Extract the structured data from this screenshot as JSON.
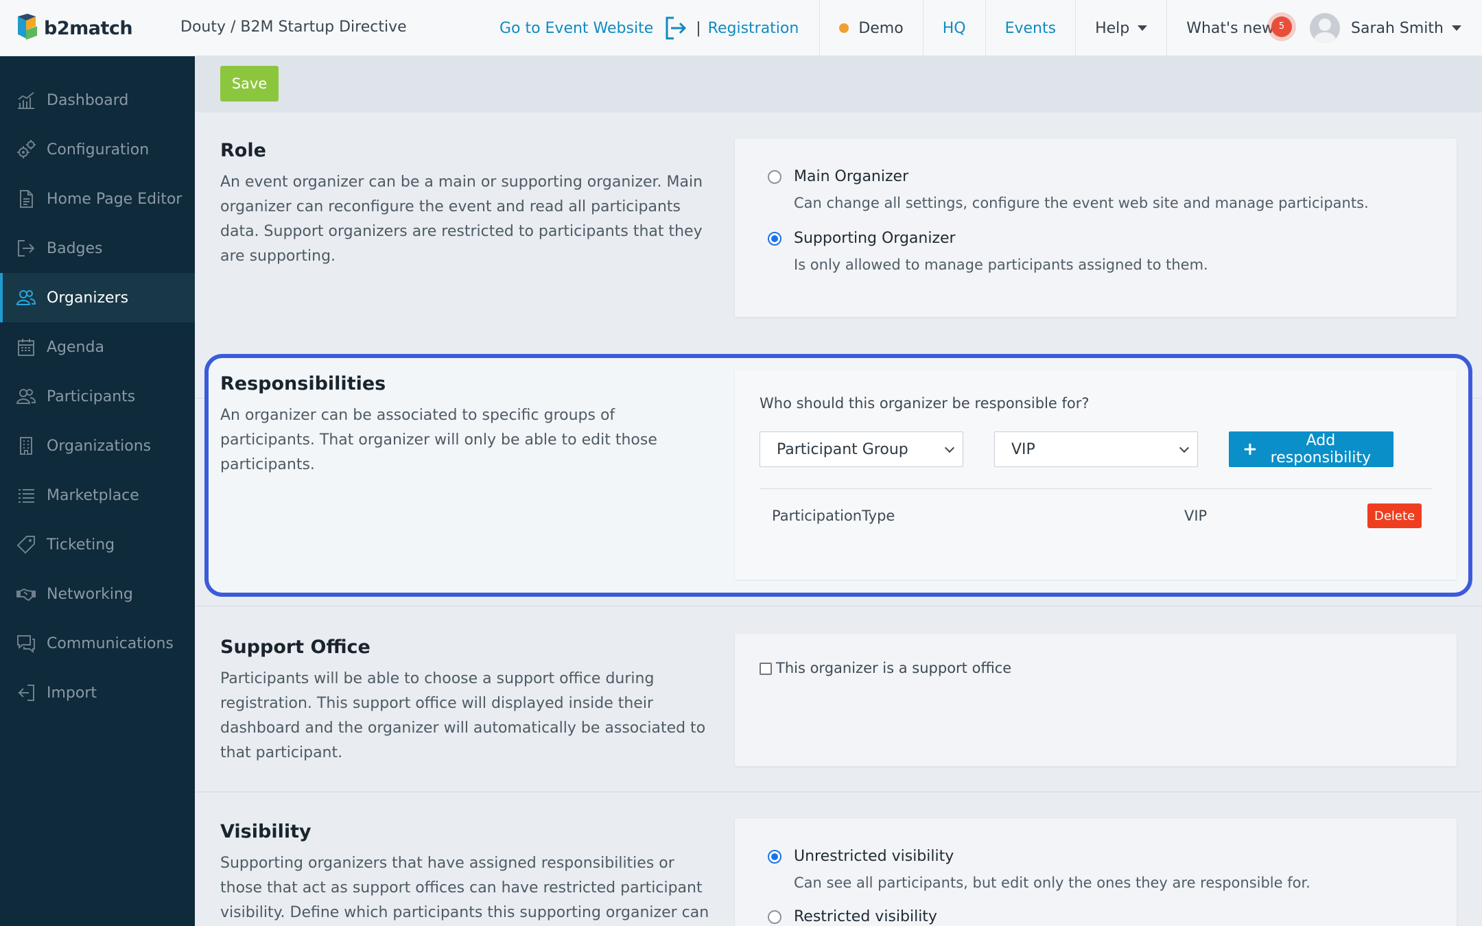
{
  "header": {
    "brand": "b2match",
    "event_path": "Douty / B2M Startup Directive",
    "go_to_site": "Go to Event Website",
    "separator": "|",
    "registration": "Registration",
    "demo": "Demo",
    "hq": "HQ",
    "events": "Events",
    "help": "Help",
    "whats_new": "What's new",
    "whats_new_count": "5",
    "user_name": "Sarah Smith"
  },
  "sidebar": {
    "items": [
      {
        "label": "Dashboard",
        "icon": "dashboard-icon"
      },
      {
        "label": "Configuration",
        "icon": "gears-icon"
      },
      {
        "label": "Home Page Editor",
        "icon": "document-icon"
      },
      {
        "label": "Badges",
        "icon": "sign-in-icon"
      },
      {
        "label": "Organizers",
        "icon": "users-icon",
        "active": true
      },
      {
        "label": "Agenda",
        "icon": "calendar-icon"
      },
      {
        "label": "Participants",
        "icon": "users-icon"
      },
      {
        "label": "Organizations",
        "icon": "building-icon"
      },
      {
        "label": "Marketplace",
        "icon": "list-icon"
      },
      {
        "label": "Ticketing",
        "icon": "tag-icon"
      },
      {
        "label": "Networking",
        "icon": "handshake-icon"
      },
      {
        "label": "Communications",
        "icon": "chat-icon"
      },
      {
        "label": "Import",
        "icon": "import-icon"
      }
    ]
  },
  "toolbar": {
    "save_label": "Save"
  },
  "role": {
    "title": "Role",
    "description": "An event organizer can be a main or supporting organizer. Main organizer can reconfigure the event and read all participants data. Support organizers are restricted to participants that they are supporting.",
    "options": [
      {
        "label": "Main Organizer",
        "sub": "Can change all settings, configure the event web site and manage participants.",
        "checked": false
      },
      {
        "label": "Supporting Organizer",
        "sub": "Is only allowed to manage participants assigned to them.",
        "checked": true
      }
    ]
  },
  "responsibilities": {
    "title": "Responsibilities",
    "description": "An organizer can be associated to specific groups of participants. That organizer will only be able to edit those participants.",
    "question": "Who should this organizer be responsible for?",
    "type_select": "Participant Group",
    "value_select": "VIP",
    "add_label": "Add responsibility",
    "rows": [
      {
        "type": "ParticipationType",
        "value": "VIP",
        "delete_label": "Delete"
      }
    ]
  },
  "support_office": {
    "title": "Support Office",
    "description": "Participants will be able to choose a support office during registration. This support office will displayed inside their dashboard and the organizer will automatically be associated to that participant.",
    "checkbox_label": "This organizer is a support office"
  },
  "visibility": {
    "title": "Visibility",
    "description": "Supporting organizers that have assigned responsibilities or those that act as support offices can have restricted participant visibility. Define which participants this supporting organizer can see.",
    "options": [
      {
        "label": "Unrestricted visibility",
        "sub": "Can see all participants, but edit only the ones they are responsible for.",
        "checked": true
      },
      {
        "label": "Restricted visibility",
        "sub": "",
        "checked": false
      }
    ]
  },
  "colors": {
    "sidebar_bg": "#0f2a3a",
    "accent_blue": "#0f8bbf",
    "save_green": "#8cc63f",
    "delete_red": "#ee3e1f",
    "highlight": "#3b5bdb"
  }
}
